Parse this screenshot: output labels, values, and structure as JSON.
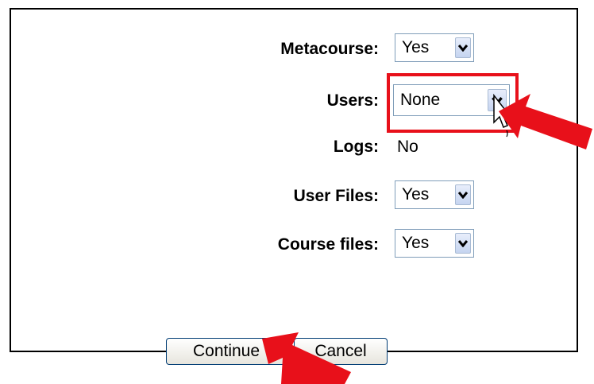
{
  "form": {
    "metacourse": {
      "label": "Metacourse:",
      "value": "Yes"
    },
    "users": {
      "label": "Users:",
      "value": "None"
    },
    "logs": {
      "label": "Logs:",
      "value": "No"
    },
    "user_files": {
      "label": "User Files:",
      "value": "Yes"
    },
    "course_files": {
      "label": "Course files:",
      "value": "Yes"
    }
  },
  "buttons": {
    "continue": "Continue",
    "cancel": "Cancel"
  },
  "annotation_colors": {
    "arrow": "#e8101a",
    "highlight_box": "#e8101a"
  },
  "icons": {
    "dropdown": "chevron-down-icon",
    "pointer": "mouse-cursor-icon",
    "annotation_arrow": "red-arrow-icon"
  }
}
